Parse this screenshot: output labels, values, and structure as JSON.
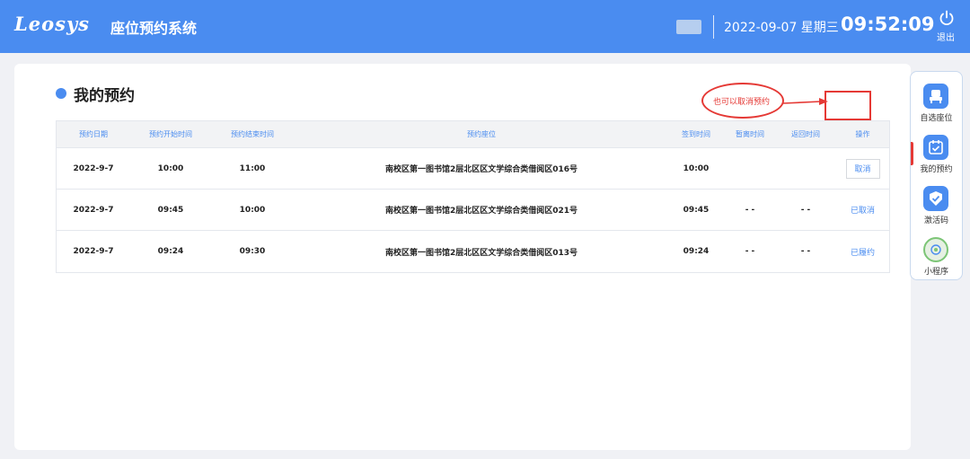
{
  "header": {
    "logo": "Leosys",
    "app_title": "座位预约系统",
    "date": "2022-09-07 星期三",
    "time": "09:52:09",
    "logout_label": "退出"
  },
  "page": {
    "title": "我的预约"
  },
  "table": {
    "columns": [
      "预约日期",
      "预约开始时间",
      "预约结束时间",
      "预约座位",
      "签到时间",
      "暂离时间",
      "返回时间",
      "操作"
    ],
    "rows": [
      {
        "date": "2022-9-7",
        "start": "10:00",
        "end": "11:00",
        "seat": "南校区第一图书馆2层北区区文学综合类借阅区016号",
        "checkin": "10:00",
        "away": "",
        "return": "",
        "action": "取消"
      },
      {
        "date": "2022-9-7",
        "start": "09:45",
        "end": "10:00",
        "seat": "南校区第一图书馆2层北区区文学综合类借阅区021号",
        "checkin": "09:45",
        "away": "- -",
        "return": "- -",
        "action": "已取消"
      },
      {
        "date": "2022-9-7",
        "start": "09:24",
        "end": "09:30",
        "seat": "南校区第一图书馆2层北区区文学综合类借阅区013号",
        "checkin": "09:24",
        "away": "- -",
        "return": "- -",
        "action": "已履约"
      }
    ]
  },
  "annotation": {
    "text": "也可以取消预约"
  },
  "sidebar": {
    "items": [
      {
        "label": "自选座位",
        "icon": "chair-icon"
      },
      {
        "label": "我的预约",
        "icon": "calendar-check-icon"
      },
      {
        "label": "激活码",
        "icon": "badge-check-icon"
      },
      {
        "label": "小程序",
        "icon": "mini-program-icon"
      }
    ]
  },
  "colors": {
    "primary": "#4a8cf0",
    "annotation": "#e53935",
    "background": "#f0f1f5"
  }
}
